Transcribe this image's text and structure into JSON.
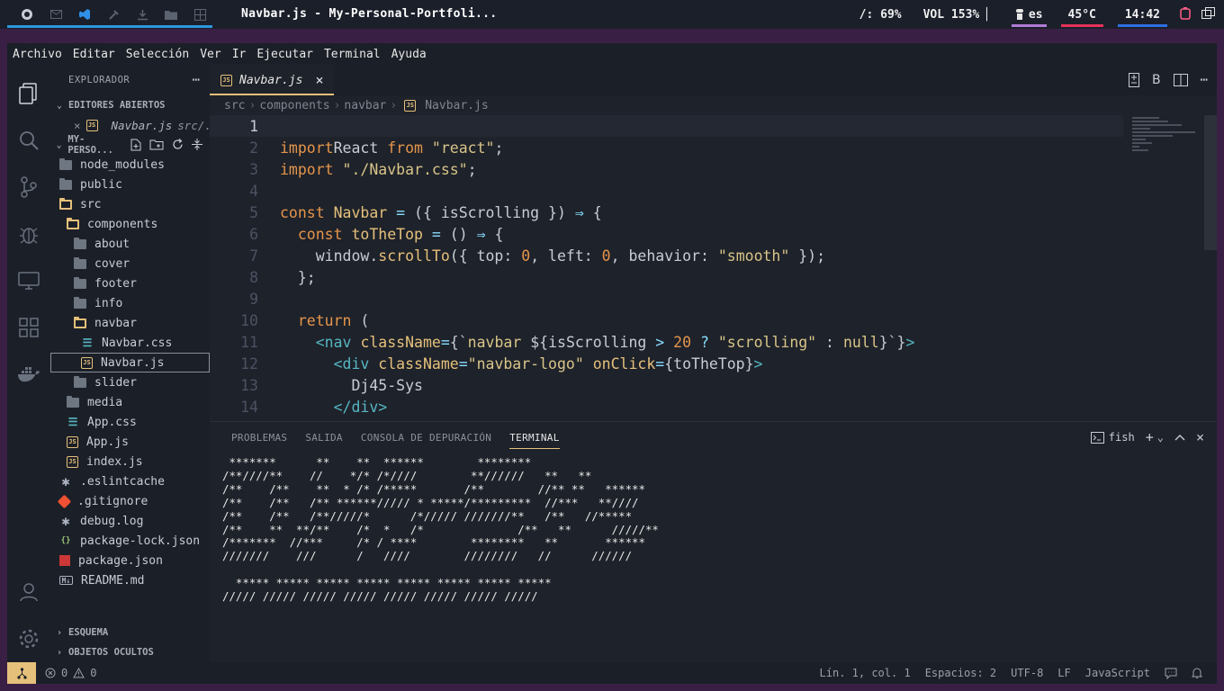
{
  "system_bar": {
    "window_title": "Navbar.js - My-Personal-Portfoli...",
    "brightness": "/: 69%",
    "volume": "VOL 153% ▏",
    "keyboard": "es",
    "temperature": "45°C",
    "clock": "14:42",
    "colors": {
      "keyboard": "#b07bd6",
      "temperature": "#e5315a",
      "clock": "#2d6fe0",
      "workspace_underline": "#2d98da"
    }
  },
  "menu": [
    "Archivo",
    "Editar",
    "Selección",
    "Ver",
    "Ir",
    "Ejecutar",
    "Terminal",
    "Ayuda"
  ],
  "sidebar": {
    "title": "EXPLORADOR",
    "open_editors_label": "EDITORES ABIERTOS",
    "open_editor": {
      "name": "Navbar.js",
      "path": "src/..."
    },
    "project_label": "MY-PERSO...",
    "tree": [
      {
        "name": "node_modules",
        "type": "folder",
        "depth": 0
      },
      {
        "name": "public",
        "type": "folder",
        "depth": 0
      },
      {
        "name": "src",
        "type": "folder-open",
        "depth": 0
      },
      {
        "name": "components",
        "type": "folder-open",
        "depth": 1
      },
      {
        "name": "about",
        "type": "folder",
        "depth": 2
      },
      {
        "name": "cover",
        "type": "folder",
        "depth": 2
      },
      {
        "name": "footer",
        "type": "folder",
        "depth": 2
      },
      {
        "name": "info",
        "type": "folder",
        "depth": 2
      },
      {
        "name": "navbar",
        "type": "folder-open",
        "depth": 2
      },
      {
        "name": "Navbar.css",
        "type": "css",
        "depth": 3
      },
      {
        "name": "Navbar.js",
        "type": "js",
        "depth": 3,
        "selected": true
      },
      {
        "name": "slider",
        "type": "folder",
        "depth": 2
      },
      {
        "name": "media",
        "type": "folder",
        "depth": 1
      },
      {
        "name": "App.css",
        "type": "css",
        "depth": 1
      },
      {
        "name": "App.js",
        "type": "js",
        "depth": 1
      },
      {
        "name": "index.js",
        "type": "js",
        "depth": 1
      },
      {
        "name": ".eslintcache",
        "type": "star",
        "depth": 0
      },
      {
        "name": ".gitignore",
        "type": "git",
        "depth": 0
      },
      {
        "name": "debug.log",
        "type": "star",
        "depth": 0
      },
      {
        "name": "package-lock.json",
        "type": "json",
        "depth": 0
      },
      {
        "name": "package.json",
        "type": "npm",
        "depth": 0
      },
      {
        "name": "README.md",
        "type": "md",
        "depth": 0
      }
    ],
    "outline_label": "ESQUEMA",
    "timeline_label": "OBJETOS OCULTOS"
  },
  "editor": {
    "tab_name": "Navbar.js",
    "breadcrumb": [
      "src",
      "components",
      "navbar",
      "Navbar.js"
    ],
    "current_line": 1,
    "lines": [
      [],
      [
        [
          "kw",
          "import"
        ],
        [
          "",
          "React "
        ],
        [
          "kw",
          "from"
        ],
        [
          "",
          " "
        ],
        [
          "str",
          "\"react\""
        ],
        [
          "",
          ";"
        ]
      ],
      [
        [
          "kw",
          "import"
        ],
        [
          "",
          " "
        ],
        [
          "str",
          "\"./Navbar.css\""
        ],
        [
          "",
          ";"
        ]
      ],
      [],
      [
        [
          "kw",
          "const"
        ],
        [
          "",
          " "
        ],
        [
          "fn",
          "Navbar"
        ],
        [
          "punc",
          " = "
        ],
        [
          "",
          "({ isScrolling }) "
        ],
        [
          "punc",
          "⇒"
        ],
        [
          "",
          " {"
        ]
      ],
      [
        [
          "",
          "  "
        ],
        [
          "kw",
          "const"
        ],
        [
          "",
          " "
        ],
        [
          "fn",
          "toTheTop"
        ],
        [
          "punc",
          " = "
        ],
        [
          "",
          "() "
        ],
        [
          "punc",
          "⇒"
        ],
        [
          "",
          " {"
        ]
      ],
      [
        [
          "",
          "    window."
        ],
        [
          "fn",
          "scrollTo"
        ],
        [
          "",
          "({ top: "
        ],
        [
          "num",
          "0"
        ],
        [
          "",
          ", left: "
        ],
        [
          "num",
          "0"
        ],
        [
          "",
          ", behavior: "
        ],
        [
          "str",
          "\"smooth\""
        ],
        [
          "",
          " });"
        ]
      ],
      [
        [
          "",
          "  };"
        ]
      ],
      [],
      [
        [
          "",
          "  "
        ],
        [
          "kw",
          "return"
        ],
        [
          "",
          " ("
        ]
      ],
      [
        [
          "",
          "    "
        ],
        [
          "tag",
          "<nav"
        ],
        [
          "",
          " "
        ],
        [
          "attr",
          "className"
        ],
        [
          "punc",
          "="
        ],
        [
          "",
          "{`"
        ],
        [
          "str",
          "navbar "
        ],
        [
          "",
          "${isScrolling "
        ],
        [
          "punc",
          ">"
        ],
        [
          "",
          " "
        ],
        [
          "num",
          "20"
        ],
        [
          "",
          " "
        ],
        [
          "punc",
          "?"
        ],
        [
          "",
          " "
        ],
        [
          "str",
          "\"scrolling\""
        ],
        [
          "",
          " : "
        ],
        [
          "str",
          "null"
        ],
        [
          "",
          "}`}"
        ],
        [
          "tag",
          ">"
        ]
      ],
      [
        [
          "",
          "      "
        ],
        [
          "tag",
          "<div"
        ],
        [
          "",
          " "
        ],
        [
          "attr",
          "className"
        ],
        [
          "punc",
          "="
        ],
        [
          "str",
          "\"navbar-logo\""
        ],
        [
          "",
          " "
        ],
        [
          "attr",
          "onClick"
        ],
        [
          "punc",
          "="
        ],
        [
          "",
          "{toTheTop}"
        ],
        [
          "tag",
          ">"
        ]
      ],
      [
        [
          "",
          "        Dj45-Sys"
        ]
      ],
      [
        [
          "",
          "      "
        ],
        [
          "tag",
          "</div>"
        ]
      ]
    ]
  },
  "panel": {
    "tabs": [
      "PROBLEMAS",
      "SALIDA",
      "CONSOLA DE DEPURACIÓN",
      "TERMINAL"
    ],
    "active_tab": "TERMINAL",
    "shell": "fish",
    "terminal_output": " *******      **    **  ******        ********\n/**////**    //    */* /*////        **//////   **   **\n/**    /**    **  * /* /*****       /**        //** **   ******\n/**    /**   /** ******///// * *****/*********  //***   **////\n/**    /**   /**/////*      /*///// ///////**   /**   //*****\n/**    **  **/**    /*  *   /*              /**   **      /////**\n/*******  //***     /* / ****        ********   **       ******\n///////    ///      /   ////        ////////   //      //////\n\n  ***** ***** ***** ***** ***** ***** ***** *****\n///// ///// ///// ///// ///// ///// ///// /////"
  },
  "status": {
    "errors": "0",
    "warnings": "0",
    "position": "Lín. 1, col. 1",
    "spaces": "Espacios: 2",
    "encoding": "UTF-8",
    "eol": "LF",
    "language": "JavaScript"
  }
}
